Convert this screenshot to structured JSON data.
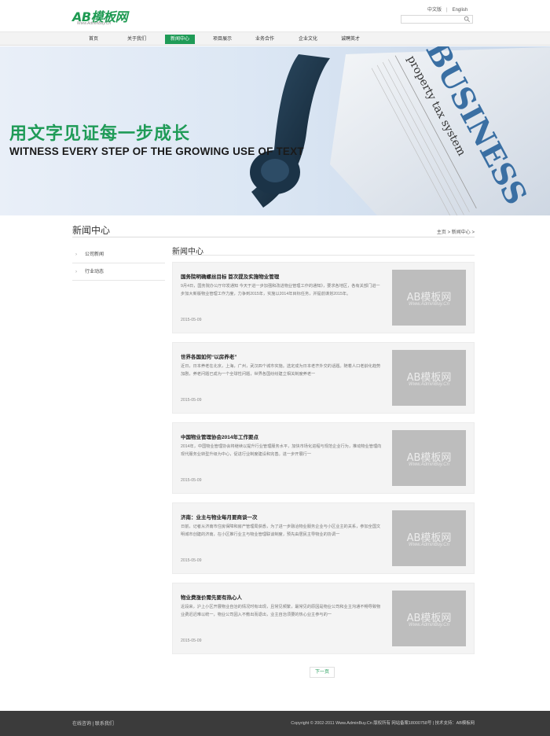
{
  "header": {
    "logo_text": "AB模板网",
    "logo_sub": "Www.AdminBuy.Cn",
    "lang_cn": "中文版",
    "lang_sep": "|",
    "lang_en": "English",
    "search_placeholder": ""
  },
  "nav": {
    "items": [
      {
        "label": "首页"
      },
      {
        "label": "关于我们"
      },
      {
        "label": "新闻中心"
      },
      {
        "label": "项目展示"
      },
      {
        "label": "业务合作"
      },
      {
        "label": "企业文化"
      },
      {
        "label": "诚聘英才"
      }
    ],
    "active_index": 2
  },
  "banner": {
    "title_cn": "用文字见证每一步成长",
    "title_en": "WITNESS EVERY STEP OF THE GROWING USE OF TEXT",
    "paper_word": "BUSINESS",
    "paper_sub": "property tax system"
  },
  "page": {
    "title": "新闻中心",
    "breadcrumb_home": "主页",
    "breadcrumb_sep": ">",
    "breadcrumb_current": "新闻中心",
    "breadcrumb_tail": ">"
  },
  "sidebar": {
    "items": [
      {
        "label": "公司新闻"
      },
      {
        "label": "行业动态"
      }
    ]
  },
  "main": {
    "title": "新闻中心",
    "thumb_text": "AB模板网",
    "thumb_sub": "Www.AdminBuy.Cn",
    "news": [
      {
        "title": "国务院明确螺丝目标 首次提及实施物业管理",
        "desc": "9月4日，国务院办公厅印发通知 今天于进一步加强和改进物业管理工作的通知》，要求各地区，各有关部门进一步加大新版物业管理工作力度，力争到2015年，实施以2014年目标任务，并提前谋划2015年。",
        "date": "2015-05-09"
      },
      {
        "title": "世界各国如何“以房养老”",
        "desc": "近日，日本养老在北京，上海，广州，武汉四个城市实施。选定成为日本老齐外交的话题。随着人口老龄化趋势加剧，养老问题已成为一个全球性问题，世界各国纷纷建立相关制度养老一",
        "date": "2015-05-09"
      },
      {
        "title": "中国物业管理协会2014年工作要点",
        "desc": "2014年，中国物业管理协会将继续以提升行业管理服务水平，加快市场化进程与规范企业行为，推动物业管理向现代服务业转型升级为中心，促进行业制度建设和完善。进一步开展行一",
        "date": "2015-05-09"
      },
      {
        "title": "济南：业主与物业每月要商谈一次",
        "desc": "日前，记者从济南市住房保障和房产管理局获悉，为了进一步融洽物业服务企业与小区业主的关系，参加全国文明城市创建的济南，在小区推行业主与物业管理联谈制度，预先由居民主导物业的协调一",
        "date": "2015-05-09"
      },
      {
        "title": "物业费涨价需先要有热心人",
        "desc": "近段来，沪上小区开展物业自治的情况时有出现，且常见频繁，最常见的原因是物业公司和业主沟通不畅导致物业费迟迟难以统一，物业公司因入不敷出而退出，业主自治须要的热心业主参与的一",
        "date": "2015-05-09"
      }
    ]
  },
  "pager": {
    "next_label": "下一页"
  },
  "footer": {
    "left": "在线咨询 | 联系我们",
    "right": "Copyright © 2002-2011 Www.AdminBuy.Cn 版权所有  网站备案18000758号  |  技术支持：AB模板网"
  },
  "colors": {
    "brand_green": "#1f9b57",
    "footer_bg": "#3b3b3b"
  }
}
